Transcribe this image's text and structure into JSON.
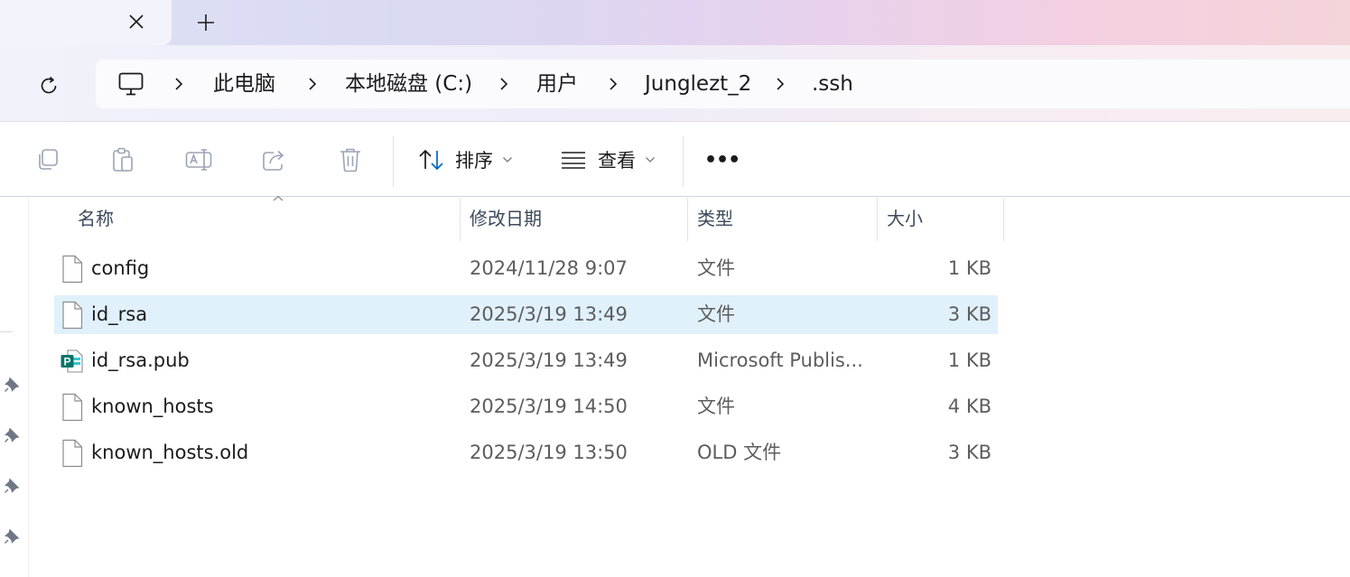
{
  "tabs": {
    "close_icon": "close-icon",
    "new_tab_icon": "plus-icon"
  },
  "navigation": {
    "refresh_icon": "refresh-icon"
  },
  "address": {
    "root_icon": "this-pc-icon",
    "crumbs": [
      "此电脑",
      "本地磁盘 (C:)",
      "用户",
      "Junglezt_2",
      ".ssh"
    ]
  },
  "toolbar": {
    "copy_icon": "copy-icon",
    "paste_icon": "paste-icon",
    "rename_icon": "rename-icon",
    "share_icon": "share-icon",
    "delete_icon": "delete-icon",
    "sort_label": "排序",
    "view_label": "查看",
    "more_label": "•••"
  },
  "columns": {
    "name": "名称",
    "date": "修改日期",
    "type": "类型",
    "size": "大小"
  },
  "files": [
    {
      "name": "config",
      "date": "2024/11/28 9:07",
      "type": "文件",
      "size": "1 KB",
      "icon": "file-icon",
      "selected": false
    },
    {
      "name": "id_rsa",
      "date": "2025/3/19 13:49",
      "type": "文件",
      "size": "3 KB",
      "icon": "file-icon",
      "selected": true
    },
    {
      "name": "id_rsa.pub",
      "date": "2025/3/19 13:49",
      "type": "Microsoft Publis...",
      "size": "1 KB",
      "icon": "publisher-file-icon",
      "selected": false
    },
    {
      "name": "known_hosts",
      "date": "2025/3/19 14:50",
      "type": "文件",
      "size": "4 KB",
      "icon": "file-icon",
      "selected": false
    },
    {
      "name": "known_hosts.old",
      "date": "2025/3/19 13:50",
      "type": "OLD 文件",
      "size": "3 KB",
      "icon": "file-icon",
      "selected": false
    }
  ],
  "colors": {
    "selection": "#e0f1fb",
    "accent": "#0067c0",
    "publisher_green": "#077568"
  }
}
